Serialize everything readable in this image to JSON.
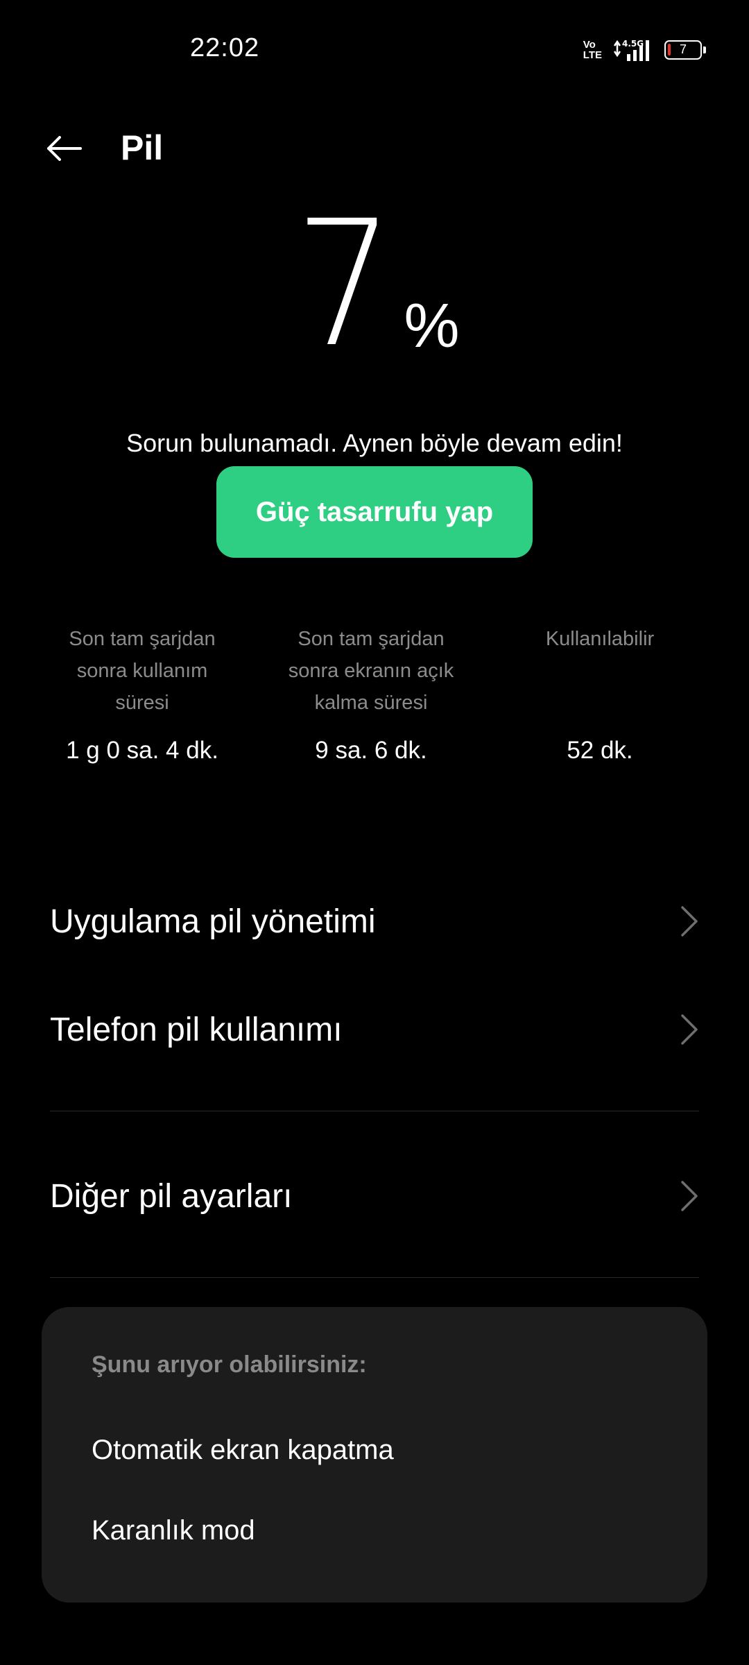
{
  "status_bar": {
    "time": "22:02",
    "volte_top": "Vo",
    "volte_bottom": "LTE",
    "network": "4.5G",
    "battery_level": "7"
  },
  "header": {
    "title": "Pil"
  },
  "battery": {
    "percent": "7",
    "percent_sign": "%",
    "message": "Sorun bulunamadı. Aynen böyle devam edin!",
    "save_button_label": "Güç tasarrufu yap",
    "accent_color": "#2ecf82"
  },
  "stats": [
    {
      "label": "Son tam şarjdan sonra kullanım süresi",
      "value": "1 g 0 sa. 4 dk."
    },
    {
      "label": "Son tam şarjdan sonra ekranın açık kalma süresi",
      "value": "9 sa. 6 dk."
    },
    {
      "label": "Kullanılabilir",
      "value": "52 dk."
    }
  ],
  "menu": {
    "app_battery_management": "Uygulama pil yönetimi",
    "phone_battery_usage": "Telefon pil kullanımı",
    "other_battery_settings": "Diğer pil ayarları"
  },
  "suggestions": {
    "title": "Şunu arıyor olabilirsiniz:",
    "items": [
      "Otomatik ekran kapatma",
      "Karanlık mod"
    ]
  }
}
